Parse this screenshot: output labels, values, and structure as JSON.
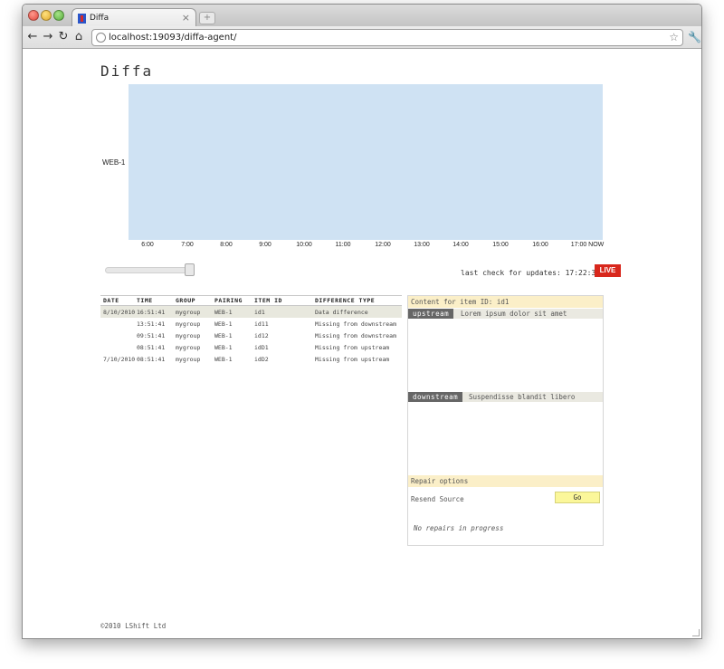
{
  "browser": {
    "tab_title": "Diffa",
    "tab_close": "×",
    "new_tab": "+",
    "url": "localhost:19093/diffa-agent/",
    "icons": {
      "back": "back-arrow-icon",
      "forward": "forward-arrow-icon",
      "reload": "reload-icon",
      "home": "home-icon",
      "bookmark": "star-icon",
      "settings": "wrench-icon"
    }
  },
  "page": {
    "title": "Diffa",
    "footer": "©2010 LShift Ltd"
  },
  "heatmap": {
    "row_label": "WEB-1",
    "color": "#cfe2f3",
    "ticks": [
      "6:00",
      "7:00",
      "8:00",
      "9:00",
      "10:00",
      "11:00",
      "12:00",
      "13:00",
      "14:00",
      "15:00",
      "16:00",
      "17:00 NOW"
    ]
  },
  "status": {
    "last_check": "last check for updates: 17:22:31s",
    "live_label": "LIVE",
    "live_color": "#d8271c"
  },
  "table": {
    "headers": [
      "DATE",
      "TIME",
      "GROUP",
      "PAIRING",
      "ITEM ID",
      "DIFFERENCE TYPE"
    ],
    "rows": [
      [
        "8/10/2010",
        "16:51:41",
        "mygroup",
        "WEB-1",
        "id1",
        "Data difference"
      ],
      [
        "",
        "13:51:41",
        "mygroup",
        "WEB-1",
        "id11",
        "Missing from downstream"
      ],
      [
        "",
        "09:51:41",
        "mygroup",
        "WEB-1",
        "id12",
        "Missing from downstream"
      ],
      [
        "",
        "08:51:41",
        "mygroup",
        "WEB-1",
        "idD1",
        "Missing from upstream"
      ],
      [
        "7/10/2010",
        "08:51:41",
        "mygroup",
        "WEB-1",
        "idD2",
        "Missing from upstream"
      ]
    ]
  },
  "content": {
    "header": "Content for item ID: id1",
    "upstream_label": "upstream",
    "upstream_text": "Lorem ipsum dolor sit amet",
    "downstream_label": "downstream",
    "downstream_text": "Suspendisse blandit libero"
  },
  "repair": {
    "header": "Repair options",
    "action_label": "Resend Source",
    "go_label": "Go",
    "status": "No repairs in progress"
  }
}
